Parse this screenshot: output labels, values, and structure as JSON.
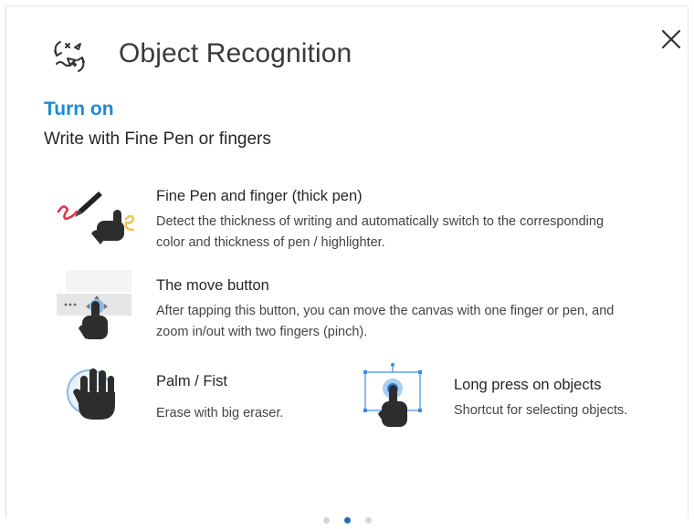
{
  "dialog": {
    "title": "Object Recognition",
    "title_icon": "object-recognition-icon",
    "close_icon": "close-icon",
    "turn_on": "Turn on",
    "subtitle": "Write with Fine Pen or fingers"
  },
  "features": {
    "fine_pen": {
      "title": "Fine Pen and finger (thick pen)",
      "desc_line1": "Detect the thickness of writing and automatically switch to the corresponding",
      "desc_line2": "color and thickness of pen / highlighter.",
      "icon": "pen-and-finger-icon"
    },
    "move": {
      "title": "The move button",
      "desc_line1": "After tapping this button, you can move the canvas with one finger or pen, and",
      "desc_line2": "zoom in/out with two fingers (pinch).",
      "icon": "move-button-icon"
    },
    "palm": {
      "title": "Palm / Fist",
      "desc": "Erase with big eraser.",
      "icon": "palm-icon"
    },
    "long_press": {
      "title": "Long press on objects",
      "desc": "Shortcut for selecting objects.",
      "icon": "long-press-icon"
    }
  },
  "pagination": {
    "pages": 3,
    "active_index": 1
  },
  "colors": {
    "accent": "#1f8ad6",
    "pen_red": "#e0304a",
    "finger_yellow": "#f2c14e",
    "selection_blue": "#3a8ee6"
  }
}
